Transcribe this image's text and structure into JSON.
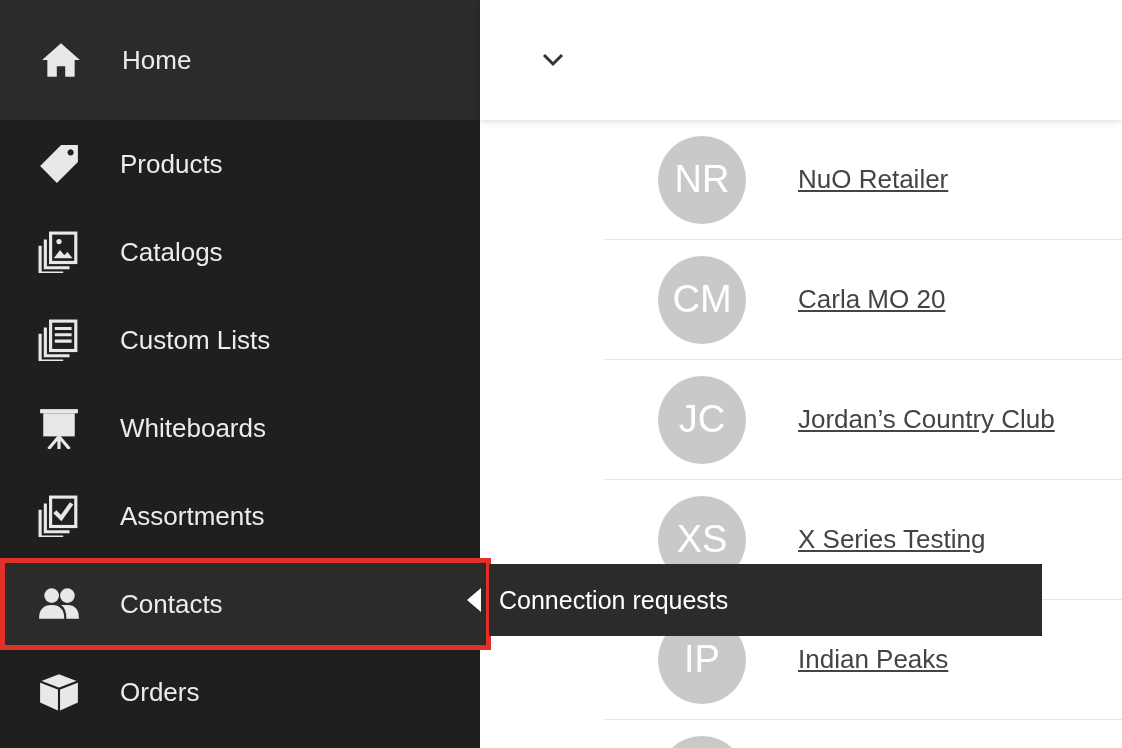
{
  "sidebar": {
    "home": {
      "label": "Home"
    },
    "items": [
      {
        "label": "Products",
        "highlighted": false
      },
      {
        "label": "Catalogs",
        "highlighted": false
      },
      {
        "label": "Custom Lists",
        "highlighted": false
      },
      {
        "label": "Whiteboards",
        "highlighted": false
      },
      {
        "label": "Assortments",
        "highlighted": false
      },
      {
        "label": "Contacts",
        "highlighted": true,
        "flyout": "Connection requests"
      },
      {
        "label": "Orders",
        "highlighted": false
      }
    ]
  },
  "contacts": [
    {
      "initials": "NR",
      "name": "NuO Retailer"
    },
    {
      "initials": "CM",
      "name": "Carla MO 20"
    },
    {
      "initials": "JC",
      "name": "Jordan’s Country Club"
    },
    {
      "initials": "XS",
      "name": "X Series Testing"
    },
    {
      "initials": "IP",
      "name": "Indian Peaks"
    }
  ]
}
